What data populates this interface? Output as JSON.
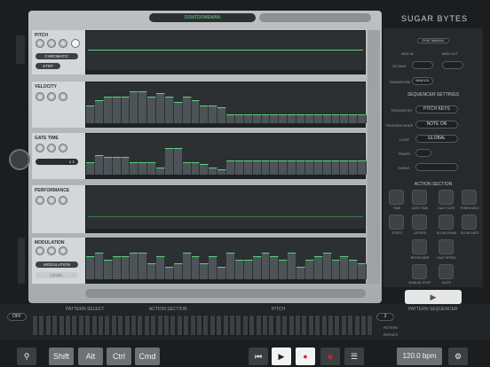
{
  "preset": {
    "name": "DONTDOMEMAN"
  },
  "brand": {
    "logo": "SUGAR BYTES"
  },
  "lanes": [
    {
      "label": "PITCH",
      "pills": [
        "CHROMATIC",
        "STEP"
      ]
    },
    {
      "label": "VELOCITY"
    },
    {
      "label": "GATE TIME",
      "value": "x 1"
    },
    {
      "label": "PERFORMANCE"
    },
    {
      "label": "MODULATION",
      "pills": [
        "MODULATION",
        "LEVEL"
      ]
    }
  ],
  "right": {
    "sync": "SYNC MANUAL",
    "midi_in": "MIDI IN",
    "midi_out": "MIDI OUT",
    "octave_label": "OCTAVE",
    "transpose_label": "TRANSPOSE",
    "transpose_val": "MAN K01",
    "seq_title": "SEQUENCER SETTINGS",
    "trigger_by_label": "TRIGGER BY",
    "trigger_by": "PITCH KEYS",
    "trigger_mode_label": "TRIGGER MODE",
    "trigger_mode": "NOTE ON",
    "loop_label": "LOOP",
    "loop": "GLOBAL",
    "tempo_label": "TEMPO",
    "swing_label": "SWING",
    "action_title": "ACTION SECTION",
    "actions": [
      "TIME",
      "GATE TIME",
      "HALF GATE",
      "THRESHOLD",
      "STEPS",
      "LOOPER",
      "SLOW DOWN",
      "SLOW GATE",
      "RETRIGGER",
      "HALF SPEED",
      "MANUAL STOP",
      "MUTE"
    ]
  },
  "bottom": {
    "off": "OFF",
    "pattern_select": "PATTERN SELECT",
    "action_section": "ACTION SECTION",
    "pitch": "PITCH",
    "pattern_seq": "PATTERN SEQUENCER",
    "pattern_num": "2",
    "pattern_label": "PATTERN",
    "repeats_label": "REPEATS"
  },
  "toolbar": {
    "shift": "Shift",
    "alt": "Alt",
    "ctrl": "Ctrl",
    "cmd": "Cmd",
    "bpm": "120.0 bpm"
  }
}
